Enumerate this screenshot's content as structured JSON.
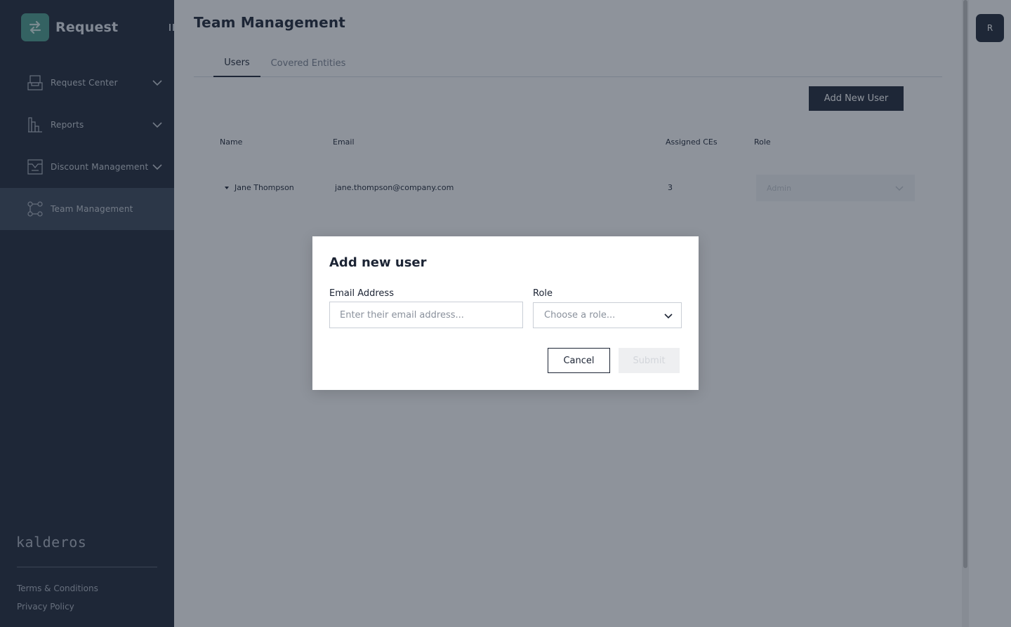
{
  "app": {
    "name": "Request",
    "logo_icon": "arrows-swap-icon",
    "brand_color": "#4a9d8d"
  },
  "sidebar": {
    "items": [
      {
        "label": "Request Center",
        "icon": "inbox-tray-icon",
        "expandable": true
      },
      {
        "label": "Reports",
        "icon": "bar-chart-icon",
        "expandable": true
      },
      {
        "label": "Discount Management",
        "icon": "discount-box-icon",
        "expandable": true
      },
      {
        "label": "Team Management",
        "icon": "team-nodes-icon",
        "active": true
      }
    ],
    "company": "kalderos",
    "footer_links": [
      "Terms & Conditions",
      "Privacy Policy"
    ]
  },
  "page": {
    "title": "Team Management",
    "tabs": [
      {
        "label": "Users",
        "active": true
      },
      {
        "label": "Covered Entities",
        "active": false
      }
    ],
    "add_button": "Add New User"
  },
  "table": {
    "columns": [
      "Name",
      "Email",
      "Assigned CEs",
      "Role"
    ],
    "rows": [
      {
        "name": "Jane Thompson",
        "email": "jane.thompson@company.com",
        "assigned_ces": "3",
        "role": "Admin"
      }
    ]
  },
  "user_avatar": {
    "initial": "R"
  },
  "modal": {
    "title": "Add new user",
    "email_label": "Email Address",
    "email_placeholder": "Enter their email address...",
    "email_value": "",
    "role_label": "Role",
    "role_placeholder": "Choose a role...",
    "cancel_label": "Cancel",
    "submit_label": "Submit"
  },
  "colors": {
    "sidebar_bg": "#1e2737",
    "active_nav": "#3a4659",
    "overlay": "rgba(30,39,55,0.5)"
  }
}
